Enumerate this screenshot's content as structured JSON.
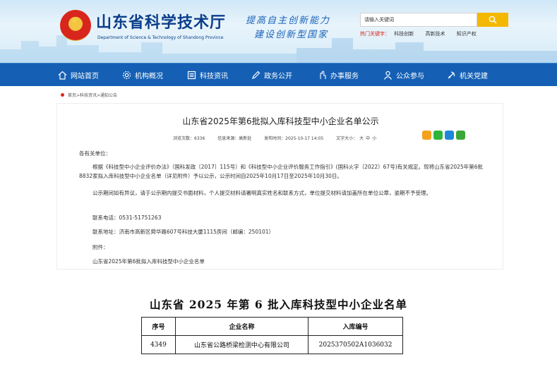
{
  "header": {
    "title": "山东省科学技术厅",
    "subtitle": "Department of Science & Technology of Shandong Province",
    "slogan_line1": "提高自主创新能力",
    "slogan_line2": "建设创新型国家",
    "search_placeholder": "请输入关键词",
    "hot_label": "热门关键字：",
    "hot_words": [
      "科技创新",
      "高新技术",
      "知识产权"
    ]
  },
  "nav": {
    "items": [
      "网站首页",
      "机构概况",
      "科技资讯",
      "政务公开",
      "办事服务",
      "公众参与",
      "机关党建"
    ]
  },
  "breadcrumb": "首页>科技资讯>通知公告",
  "article": {
    "title": "山东省2025年第6批拟入库科技型中小企业名单公示",
    "views": "浏览次数：6336",
    "source": "信息来源：高新处",
    "publish_time": "发布时间：2025-10-17 14:05",
    "font_size_label": "文字大小：",
    "font_sizes": [
      "大",
      "中",
      "小"
    ],
    "salutation": "各有关单位：",
    "paragraph1": "根据《科技型中小企业评价办法》（国科发政〔2017〕115号）和《科技型中小企业评价服务工作指引》(国科火字〔2022〕67号)有关规定。现将山东省2025年第6批8832家拟入库科技型中小企业名单（详见附件）予以公示，公示时间自2025年10月17日至2025年10月30日。",
    "paragraph2": "公示期间如有异议，请于公示期内提交书面材料，个人提交材料请署明真实姓名和联系方式，单位提交材料请加盖所在单位公章，逾期不予受理。",
    "phone": "联系电话：0531-51751263",
    "address": "联系地址：济南市高新区舜华路607号科技大厦1115房间（邮编：250101）",
    "attachment_label": "附件：",
    "attachment_link": "山东省2025年第6批拟入库科技型中小企业名单"
  },
  "scan": {
    "title": "山东省 2025 年第 6 批入库科技型中小企业名单",
    "headers": [
      "序号",
      "企业名称",
      "入库编号"
    ],
    "row": [
      "4349",
      "山东省公路桥梁检测中心有限公司",
      "2025370502A1036032"
    ]
  },
  "colors": {
    "nav_bg": "#1560b5",
    "title_blue": "#0b3e8a",
    "search_button": "#f5b800",
    "hot_red": "#d8261d"
  }
}
